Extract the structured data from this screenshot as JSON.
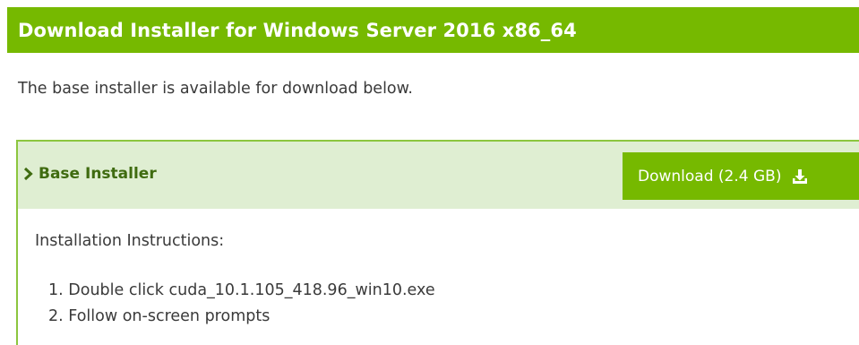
{
  "header": {
    "title": "Download Installer for Windows Server 2016 x86_64"
  },
  "intro": {
    "text": "The base installer is available for download below."
  },
  "installer": {
    "section_title": "Base Installer",
    "download_label": "Download (2.4 GB)",
    "instructions_title": "Installation Instructions:",
    "steps": [
      "1. Double click cuda_10.1.105_418.96_win10.exe",
      "2. Follow on-screen prompts"
    ]
  },
  "colors": {
    "accent": "#76b900",
    "panel_header_bg": "#dfeed2",
    "panel_border": "#8cc63f",
    "section_title": "#3f6b10",
    "body_text": "#3a3a3a"
  },
  "icons": {
    "expand": "chevron-right-icon",
    "download": "download-icon"
  }
}
